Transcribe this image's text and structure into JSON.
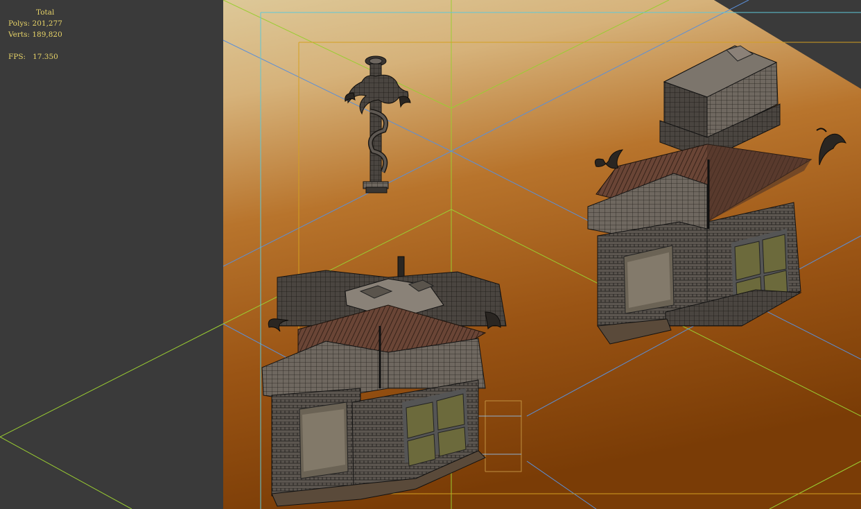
{
  "viewport": {
    "stats": {
      "total_label": "Total",
      "polys_label": "Polys:",
      "polys_value": "201,277",
      "verts_label": "Verts:",
      "verts_value": "189,820",
      "fps_label": "FPS:",
      "fps_value": "17.350"
    },
    "colors": {
      "stats_text": "#e8d468",
      "background": "#3a3a3a",
      "ground_top": "#d8c08c",
      "ground_bottom": "#7a3c08",
      "grid_green": "#9acd32",
      "grid_cyan": "#5fc8d8",
      "grid_blue": "#5b8fd8",
      "bounding_box": "#d4a020"
    },
    "objects": [
      "dragon-pillar",
      "pagoda-gate-front",
      "pagoda-gate-back"
    ]
  }
}
